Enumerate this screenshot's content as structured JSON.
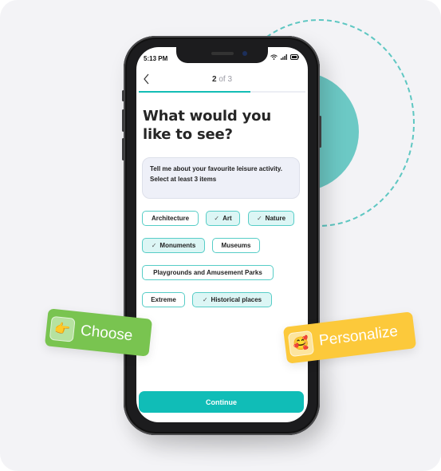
{
  "status_bar": {
    "time": "5:13 PM",
    "icons": [
      "wifi-icon",
      "signal-icon",
      "battery-icon"
    ]
  },
  "header": {
    "back_icon": "chevron-left-icon",
    "step_current": "2",
    "step_of": "of 3",
    "progress_fraction": 0.67
  },
  "main": {
    "title": "What would you like to see?",
    "info": {
      "line1": "Tell me about your favourite leisure activity.",
      "line2": "Select at least 3 items"
    },
    "chips": [
      {
        "label": "Architecture",
        "selected": false
      },
      {
        "label": "Art",
        "selected": true
      },
      {
        "label": "Nature",
        "selected": true
      },
      {
        "label": "Monuments",
        "selected": true
      },
      {
        "label": "Museums",
        "selected": false
      },
      {
        "label": "Playgrounds and Amusement Parks",
        "selected": false
      },
      {
        "label": "Extreme",
        "selected": false
      },
      {
        "label": "Historical places",
        "selected": true
      }
    ],
    "check_glyph": "✓",
    "continue_label": "Continue"
  },
  "badges": {
    "choose": {
      "label": "Choose",
      "emoji": "👉",
      "color": "#79c450"
    },
    "personalize": {
      "label": "Personalize",
      "emoji": "🥰",
      "color": "#fcc93b"
    }
  },
  "colors": {
    "accent": "#10bdb7",
    "chip_selected_bg": "#dcf6f5",
    "chip_border": "#57cdc7"
  }
}
